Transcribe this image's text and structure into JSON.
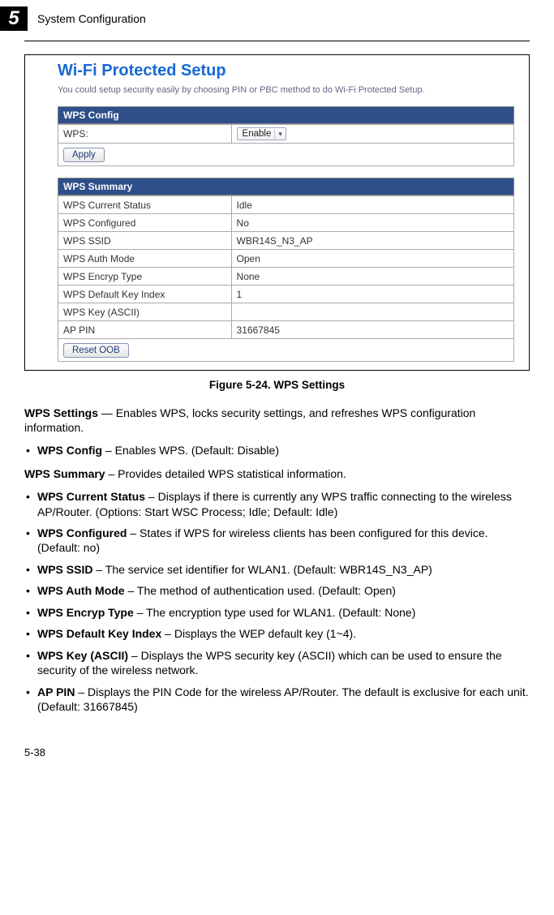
{
  "header": {
    "chapter_number": "5",
    "chapter_title": "System Configuration"
  },
  "screenshot": {
    "title": "Wi-Fi Protected Setup",
    "subtext": "You could setup security easily by choosing PIN or PBC method to do Wi-Fi Protected Setup.",
    "config_header": "WPS Config",
    "wps_label": "WPS:",
    "wps_select_value": "Enable",
    "apply_button": "Apply",
    "summary_header": "WPS Summary",
    "summary_rows": [
      {
        "label": "WPS Current Status",
        "value": "Idle"
      },
      {
        "label": "WPS Configured",
        "value": "No"
      },
      {
        "label": "WPS SSID",
        "value": "WBR14S_N3_AP"
      },
      {
        "label": "WPS Auth Mode",
        "value": "Open"
      },
      {
        "label": "WPS Encryp Type",
        "value": "None"
      },
      {
        "label": "WPS Default Key Index",
        "value": "1"
      },
      {
        "label": "WPS Key (ASCII)",
        "value": ""
      },
      {
        "label": "AP PIN",
        "value": "31667845"
      }
    ],
    "reset_button": "Reset OOB"
  },
  "caption": "Figure 5-24.   WPS Settings",
  "content": {
    "intro_bold": "WPS Settings",
    "intro_rest": " — Enables WPS, locks security settings, and refreshes WPS configuration information.",
    "bullet1_bold": "WPS Config",
    "bullet1_rest": " – Enables WPS. (Default: Disable)",
    "summary_intro_bold": "WPS Summary",
    "summary_intro_rest": " – Provides detailed WPS statistical information.",
    "b2_bold": "WPS Current Status",
    "b2_rest": " – Displays if there is currently any WPS traffic connecting to the wireless AP/Router. (Options: Start WSC Process; Idle; Default: Idle)",
    "b3_bold": "WPS Configured",
    "b3_rest": " – States if WPS for wireless clients has been configured for this device. (Default: no)",
    "b4_bold": "WPS SSID",
    "b4_rest": " – The service set identifier for WLAN1. (Default: WBR14S_N3_AP)",
    "b5_bold": "WPS Auth Mode",
    "b5_rest": " – The method of authentication used. (Default: Open)",
    "b6_bold": "WPS Encryp Type",
    "b6_rest": " – The encryption type used for WLAN1. (Default: None)",
    "b7_bold": "WPS Default Key Index",
    "b7_rest": " – Displays the WEP default key (1~4).",
    "b8_bold": "WPS Key (ASCII)",
    "b8_rest": " – Displays the WPS security key (ASCII) which can be used to ensure the security of the wireless network.",
    "b9_bold": "AP PIN",
    "b9_rest": " – Displays the PIN Code for the wireless AP/Router. The default is exclusive for each unit. (Default: 31667845)"
  },
  "page_number": "5-38"
}
